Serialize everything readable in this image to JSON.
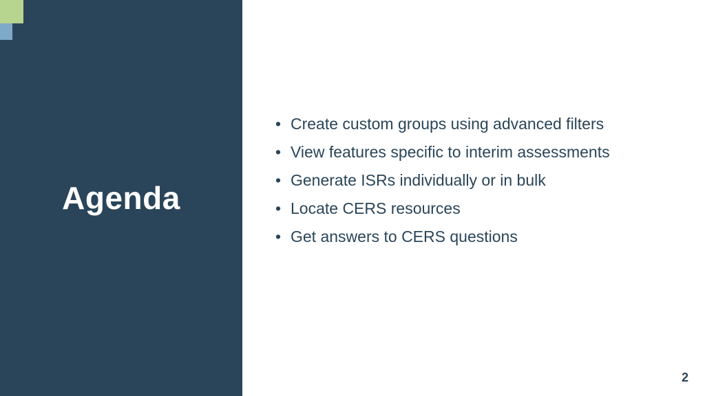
{
  "title": "Agenda",
  "bullets": [
    "Create custom groups using advanced filters",
    "View features specific to interim assessments",
    "Generate ISRs individually or in bulk",
    "Locate CERS resources",
    "Get answers to CERS questions"
  ],
  "page_number": "2"
}
